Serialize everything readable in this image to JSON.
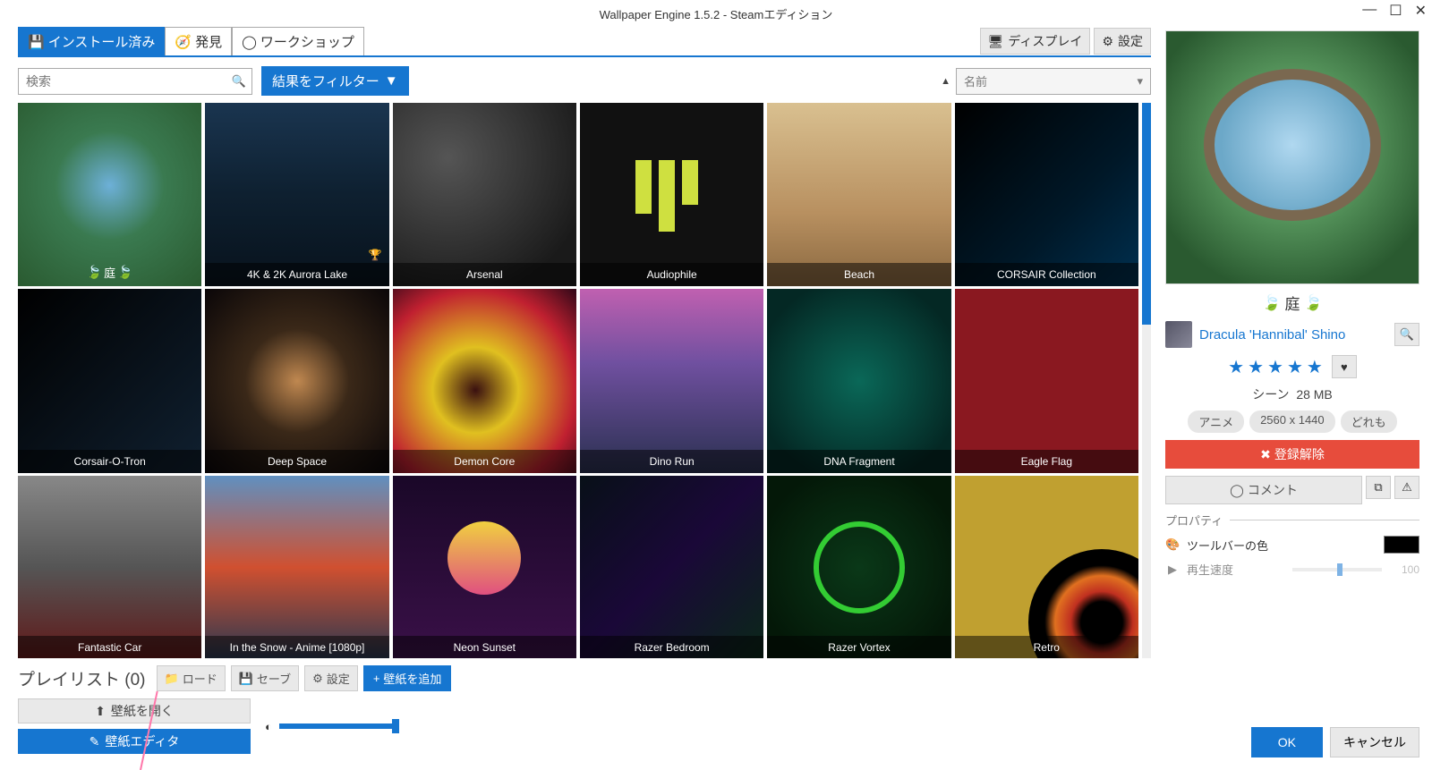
{
  "window": {
    "title": "Wallpaper Engine 1.5.2 - Steamエディション"
  },
  "tabs": {
    "installed": "インストール済み",
    "discover": "発見",
    "workshop": "ワークショップ"
  },
  "toolbar": {
    "display": "ディスプレイ",
    "settings": "設定"
  },
  "search": {
    "placeholder": "検索"
  },
  "filter": {
    "label": "結果をフィルター"
  },
  "sort": {
    "label": "名前"
  },
  "tiles": [
    {
      "title": "庭",
      "selected": true,
      "bg": "radial-gradient(circle at 50% 45%, #6db0d8 0%, #3a7a50 40%, #2a5a30 100%)"
    },
    {
      "title": "4K & 2K Aurora Lake",
      "badge": true,
      "bg": "linear-gradient(180deg,#1a3550 0%,#0e2030 50%,#08121c 100%)"
    },
    {
      "title": "Arsenal",
      "bg": "radial-gradient(ellipse at 30% 30%, #555 0%, #1a1a1a 80%)"
    },
    {
      "title": "Audiophile",
      "bg": "linear-gradient(180deg,#111 0%,#111 100%)",
      "extra": "bars"
    },
    {
      "title": "Beach",
      "bg": "linear-gradient(180deg,#d9c090 0%,#b89060 60%,#8a6840 100%)"
    },
    {
      "title": "CORSAIR Collection",
      "bg": "linear-gradient(135deg,#000 0%,#001828 60%, #003050 100%)"
    },
    {
      "title": "Corsair-O-Tron",
      "bg": "linear-gradient(135deg,#000 0%,#102030 100%)"
    },
    {
      "title": "Deep Space",
      "bg": "radial-gradient(circle at 50% 50%, #c08850 0%, #3a2818 40%, #0a0608 100%)"
    },
    {
      "title": "Demon Core",
      "bg": "radial-gradient(circle at 45% 55%, #3a1010 0%, #e0c020 30%, #c02030 70%, #300818 100%)"
    },
    {
      "title": "Dino Run",
      "bg": "linear-gradient(180deg,#c060b0 0%,#7050a0 40%,#2a3050 100%)"
    },
    {
      "title": "DNA Fragment",
      "bg": "radial-gradient(ellipse at 50% 50%, #0a6858 0%, #042824 80%)"
    },
    {
      "title": "Eagle Flag",
      "bg": "linear-gradient(90deg,#8a1820 0%,#8a1820 100%)"
    },
    {
      "title": "Fantastic Car",
      "bg": "linear-gradient(180deg,#888 0%,#555 50%,#601818 100%)"
    },
    {
      "title": "In the Snow - Anime [1080p]",
      "bg": "linear-gradient(180deg,#6090c0 0%,#d05030 50%,#2a3850 100%)"
    },
    {
      "title": "Neon Sunset",
      "bg": "linear-gradient(180deg,#1a0828 0%,#3a1048 100%)",
      "extra": "sun"
    },
    {
      "title": "Razer Bedroom",
      "bg": "linear-gradient(135deg,#081018 0%,#1a0838 50%,#0a2818 100%)"
    },
    {
      "title": "Razer Vortex",
      "bg": "radial-gradient(circle at 50% 50%, #0a3818 0%, #041808 80%)",
      "extra": "snake"
    },
    {
      "title": "Retro",
      "bg": "linear-gradient(180deg,#c0a030 0%,#c0a030 100%)",
      "extra": "arc"
    }
  ],
  "playlist": {
    "label": "プレイリスト (0)",
    "load": "ロード",
    "save": "セーブ",
    "settings": "設定",
    "add": "壁紙を追加"
  },
  "bottom": {
    "open": "壁紙を開く",
    "editor": "壁紙エディタ"
  },
  "details": {
    "title": "庭",
    "author": "Dracula 'Hannibal' Shino",
    "type_label": "シーン",
    "size": "28 MB",
    "tags": [
      "アニメ",
      "2560 x 1440",
      "どれも"
    ],
    "unsubscribe": "登録解除",
    "comment": "コメント",
    "props_header": "プロパティ",
    "prop_color": "ツールバーの色",
    "prop_speed": "再生速度",
    "prop_speed_val": "100"
  },
  "footer": {
    "ok": "OK",
    "cancel": "キャンセル"
  }
}
